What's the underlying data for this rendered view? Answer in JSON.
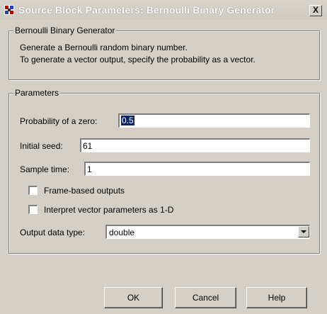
{
  "window": {
    "title": "Source Block Parameters: Bernoulli Binary Generator",
    "close_label": "X"
  },
  "description_group": {
    "legend": "Bernoulli Binary Generator",
    "lines": [
      "Generate a Bernoulli random binary number.",
      "To generate a vector output, specify the probability as a vector."
    ]
  },
  "parameters_group": {
    "legend": "Parameters",
    "probability": {
      "label": "Probability of a zero:",
      "value": "0.5"
    },
    "seed": {
      "label": "Initial seed:",
      "value": "61"
    },
    "sample_time": {
      "label": "Sample time:",
      "value": "1"
    },
    "frame_based": {
      "label": "Frame-based outputs",
      "checked": false
    },
    "interpret_1d": {
      "label": "Interpret vector parameters as 1-D",
      "checked": false
    },
    "output_type": {
      "label": "Output data type:",
      "value": "double"
    }
  },
  "buttons": {
    "ok": "OK",
    "cancel": "Cancel",
    "help": "Help"
  },
  "colors": {
    "face": "#d4d0c8",
    "selection": "#0a246a"
  }
}
